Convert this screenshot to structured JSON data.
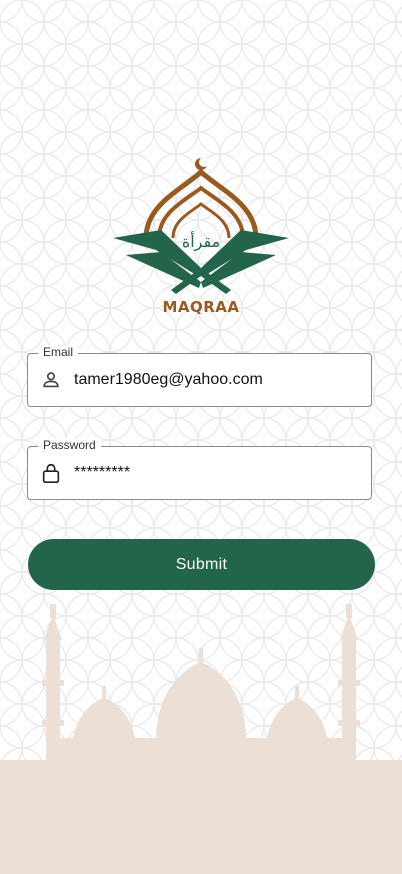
{
  "brand": {
    "name": "MAQRAA",
    "arabic_name": "مقرأة",
    "colors": {
      "brown": "#9a5a1e",
      "green": "#22654a"
    }
  },
  "form": {
    "email": {
      "label": "Email",
      "value": "tamer1980eg@yahoo.com",
      "icon": "person-icon"
    },
    "password": {
      "label": "Password",
      "value": "*********",
      "icon": "lock-icon"
    },
    "submit_label": "Submit"
  },
  "background": {
    "pattern_color": "#e7e9ef",
    "silhouette_color": "#ecdfd5"
  }
}
